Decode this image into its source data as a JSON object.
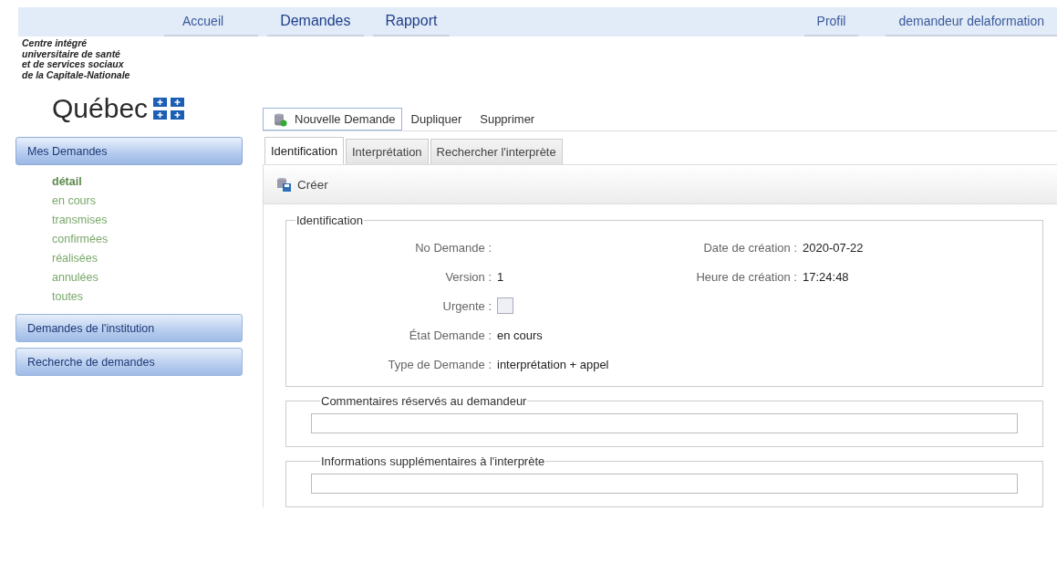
{
  "top_nav": {
    "left": [
      {
        "label": "Accueil",
        "kind": "minor"
      },
      {
        "label": "Demandes",
        "kind": "major"
      },
      {
        "label": "Rapport",
        "kind": "major"
      }
    ],
    "right": [
      {
        "label": "Profil"
      },
      {
        "label": "demandeur delaformation"
      }
    ]
  },
  "org": {
    "lines": [
      "Centre intégré",
      "universitaire de santé",
      "et de services sociaux",
      "de la Capitale-Nationale"
    ],
    "logo_text": "Québec"
  },
  "sidebar": [
    {
      "label": "Mes Demandes",
      "expanded": true,
      "items": [
        {
          "label": "détail",
          "selected": true
        },
        {
          "label": "en cours",
          "selected": false
        },
        {
          "label": "transmises",
          "selected": false
        },
        {
          "label": "confirmées",
          "selected": false
        },
        {
          "label": "réalisées",
          "selected": false
        },
        {
          "label": "annulées",
          "selected": false
        },
        {
          "label": "toutes",
          "selected": false
        }
      ]
    },
    {
      "label": "Demandes de l'institution",
      "expanded": false
    },
    {
      "label": "Recherche de demandes",
      "expanded": false
    }
  ],
  "toolbar": {
    "new": "Nouvelle Demande",
    "others": [
      "Dupliquer",
      "Supprimer"
    ]
  },
  "tabs": [
    {
      "label": "Identification",
      "selected": true
    },
    {
      "label": "Interprétation",
      "selected": false
    },
    {
      "label": "Rechercher l'interprète",
      "selected": false
    }
  ],
  "action": "Créer",
  "identification": {
    "legend": "Identification",
    "left": [
      {
        "label": "No Demande :",
        "kind": "text"
      },
      {
        "label": "Version :",
        "kind": "text",
        "value": "1"
      },
      {
        "label": "Urgente :",
        "kind": "checkbox",
        "checked": false
      },
      {
        "label": "État Demande :",
        "kind": "text",
        "value": "en cours"
      },
      {
        "label": "Type de Demande :",
        "kind": "text",
        "value": "interprétation + appel"
      }
    ],
    "right": [
      {
        "label": "Date de création :",
        "value": "2020-07-22"
      },
      {
        "label": "Heure de création :",
        "value": "17:24:48"
      }
    ]
  },
  "comment_sections": [
    {
      "legend": "Commentaires réservés au demandeur"
    },
    {
      "legend": "Informations supplémentaires à l'interprète"
    }
  ]
}
